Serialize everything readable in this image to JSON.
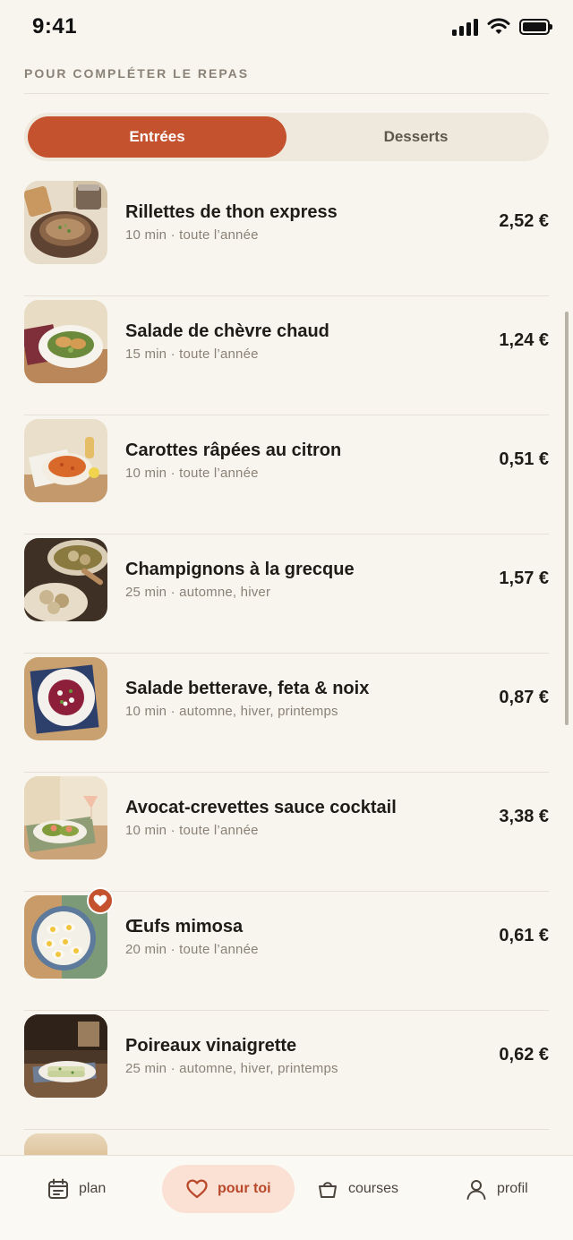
{
  "status": {
    "time": "9:41"
  },
  "section": {
    "title": "POUR COMPLÉTER LE REPAS"
  },
  "segments": [
    {
      "label": "Entrées",
      "active": true
    },
    {
      "label": "Desserts",
      "active": false
    }
  ],
  "recipes": [
    {
      "title": "Rillettes de thon express",
      "meta": "10 min · toute l’année",
      "price": "2,52 €",
      "image": "rillettes-photo"
    },
    {
      "title": "Salade de chèvre chaud",
      "meta": "15 min · toute l’année",
      "price": "1,24 €",
      "image": "salade-chevre-photo"
    },
    {
      "title": "Carottes râpées au citron",
      "meta": "10 min · toute l’année",
      "price": "0,51 €",
      "image": "carottes-photo"
    },
    {
      "title": "Champignons à la grecque",
      "meta": "25 min · automne, hiver",
      "price": "1,57 €",
      "image": "champignons-photo"
    },
    {
      "title": "Salade betterave, feta & noix",
      "meta": "10 min · automne, hiver, printemps",
      "price": "0,87 €",
      "image": "betterave-photo"
    },
    {
      "title": "Avocat-crevettes sauce cocktail",
      "meta": "10 min · toute l’année",
      "price": "3,38 €",
      "image": "avocat-photo"
    },
    {
      "title": "Œufs mimosa",
      "meta": "20 min · toute l’année",
      "price": "0,61 €",
      "image": "oeufs-photo",
      "favorite": true
    },
    {
      "title": "Poireaux vinaigrette",
      "meta": "25 min · automne, hiver, printemps",
      "price": "0,62 €",
      "image": "poireaux-photo"
    }
  ],
  "tabs": [
    {
      "label": "plan",
      "icon": "calendar-icon"
    },
    {
      "label": "pour toi",
      "icon": "heart-icon",
      "active": true
    },
    {
      "label": "courses",
      "icon": "basket-icon"
    },
    {
      "label": "profil",
      "icon": "user-icon"
    }
  ],
  "colors": {
    "accent": "#c4522f",
    "background": "#f8f5ef",
    "muted": "#8a8276",
    "activeTabBg": "#fbe1d4"
  }
}
